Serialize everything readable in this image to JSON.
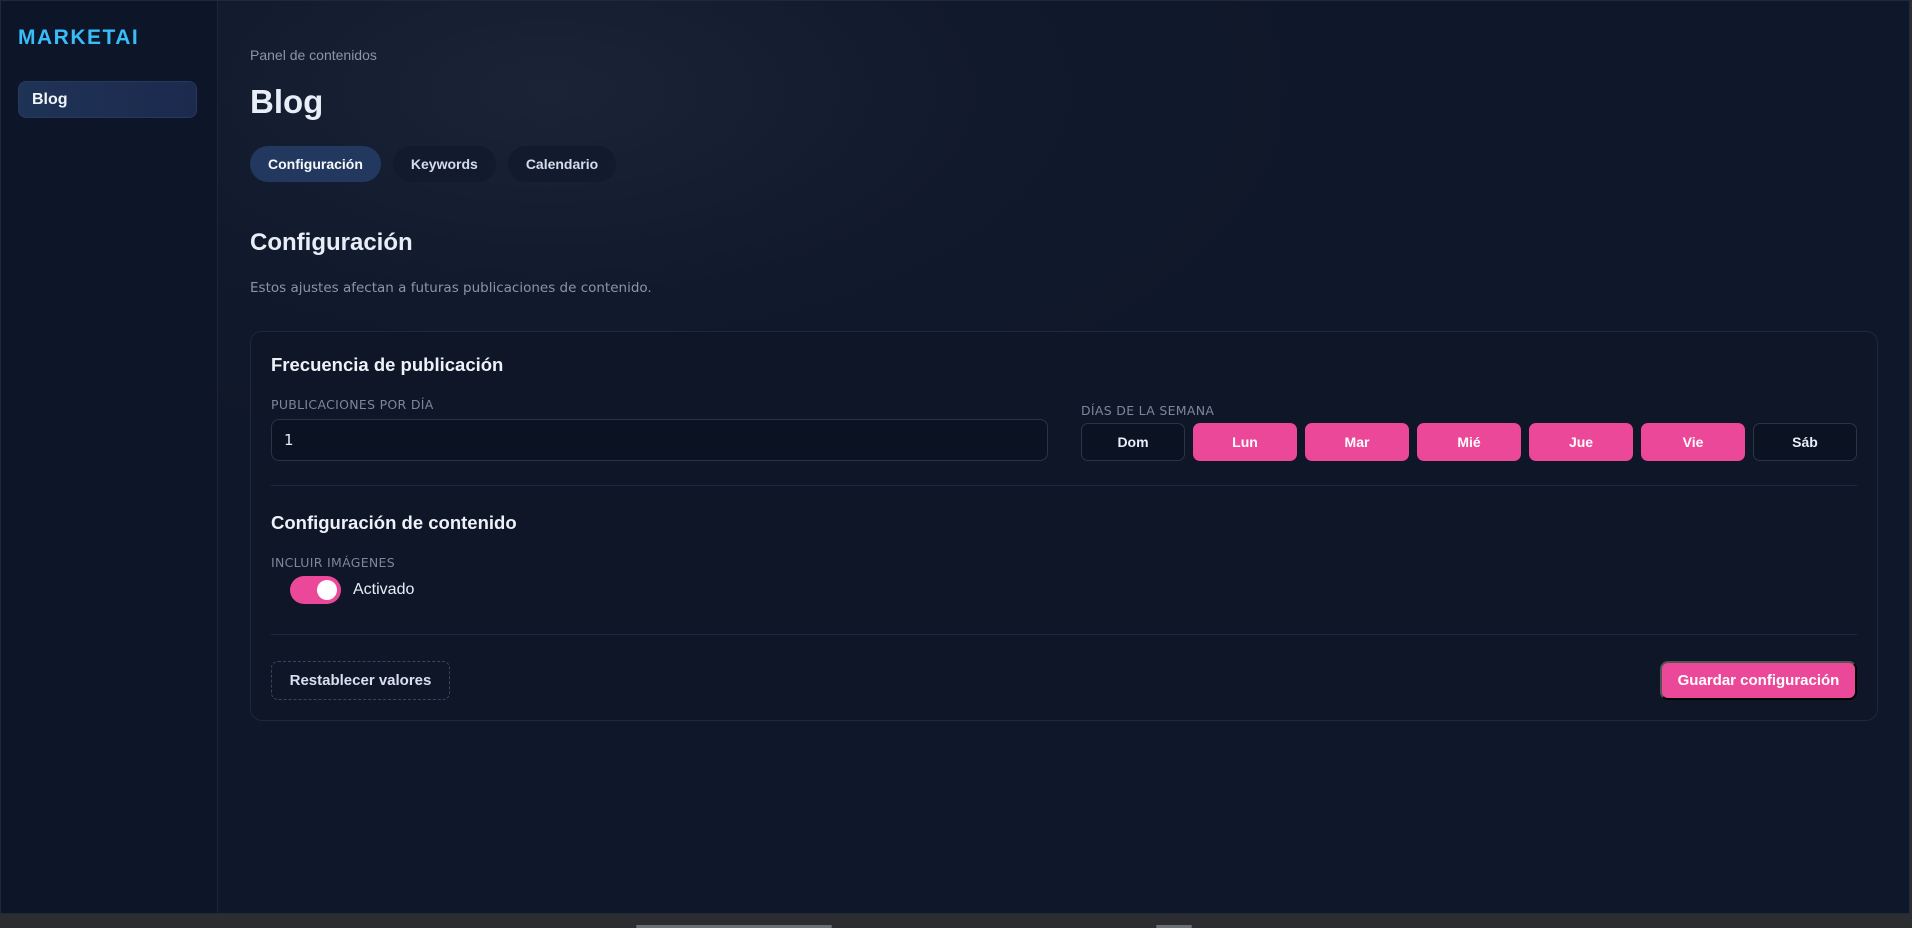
{
  "app": {
    "brand": "MARKETAI"
  },
  "sidebar": {
    "items": [
      {
        "label": "Blog",
        "active": true
      }
    ]
  },
  "header": {
    "breadcrumb": "Panel de contenidos",
    "title": "Blog",
    "tabs": [
      {
        "label": "Configuración",
        "active": true
      },
      {
        "label": "Keywords",
        "active": false
      },
      {
        "label": "Calendario",
        "active": false
      }
    ]
  },
  "section": {
    "title": "Configuración",
    "description": "Estos ajustes afectan a futuras publicaciones de contenido."
  },
  "frequency": {
    "title": "Frecuencia de publicación",
    "posts_per_day_label": "PUBLICACIONES POR DÍA",
    "posts_per_day_value": "1",
    "weekdays_label": "DÍAS DE LA SEMANA",
    "days": [
      {
        "label": "Dom",
        "selected": false
      },
      {
        "label": "Lun",
        "selected": true
      },
      {
        "label": "Mar",
        "selected": true
      },
      {
        "label": "Mié",
        "selected": true
      },
      {
        "label": "Jue",
        "selected": true
      },
      {
        "label": "Vie",
        "selected": true
      },
      {
        "label": "Sáb",
        "selected": false
      }
    ]
  },
  "content": {
    "title": "Configuración de contenido",
    "include_images_label": "INCLUIR IMÁGENES",
    "include_images_on": true,
    "include_images_status": "Activado"
  },
  "actions": {
    "reset_label": "Restablecer valores",
    "save_label": "Guardar configuración"
  },
  "colors": {
    "accent": "#ec4899",
    "brand": "#38bdf8",
    "background": "#0f172a"
  }
}
